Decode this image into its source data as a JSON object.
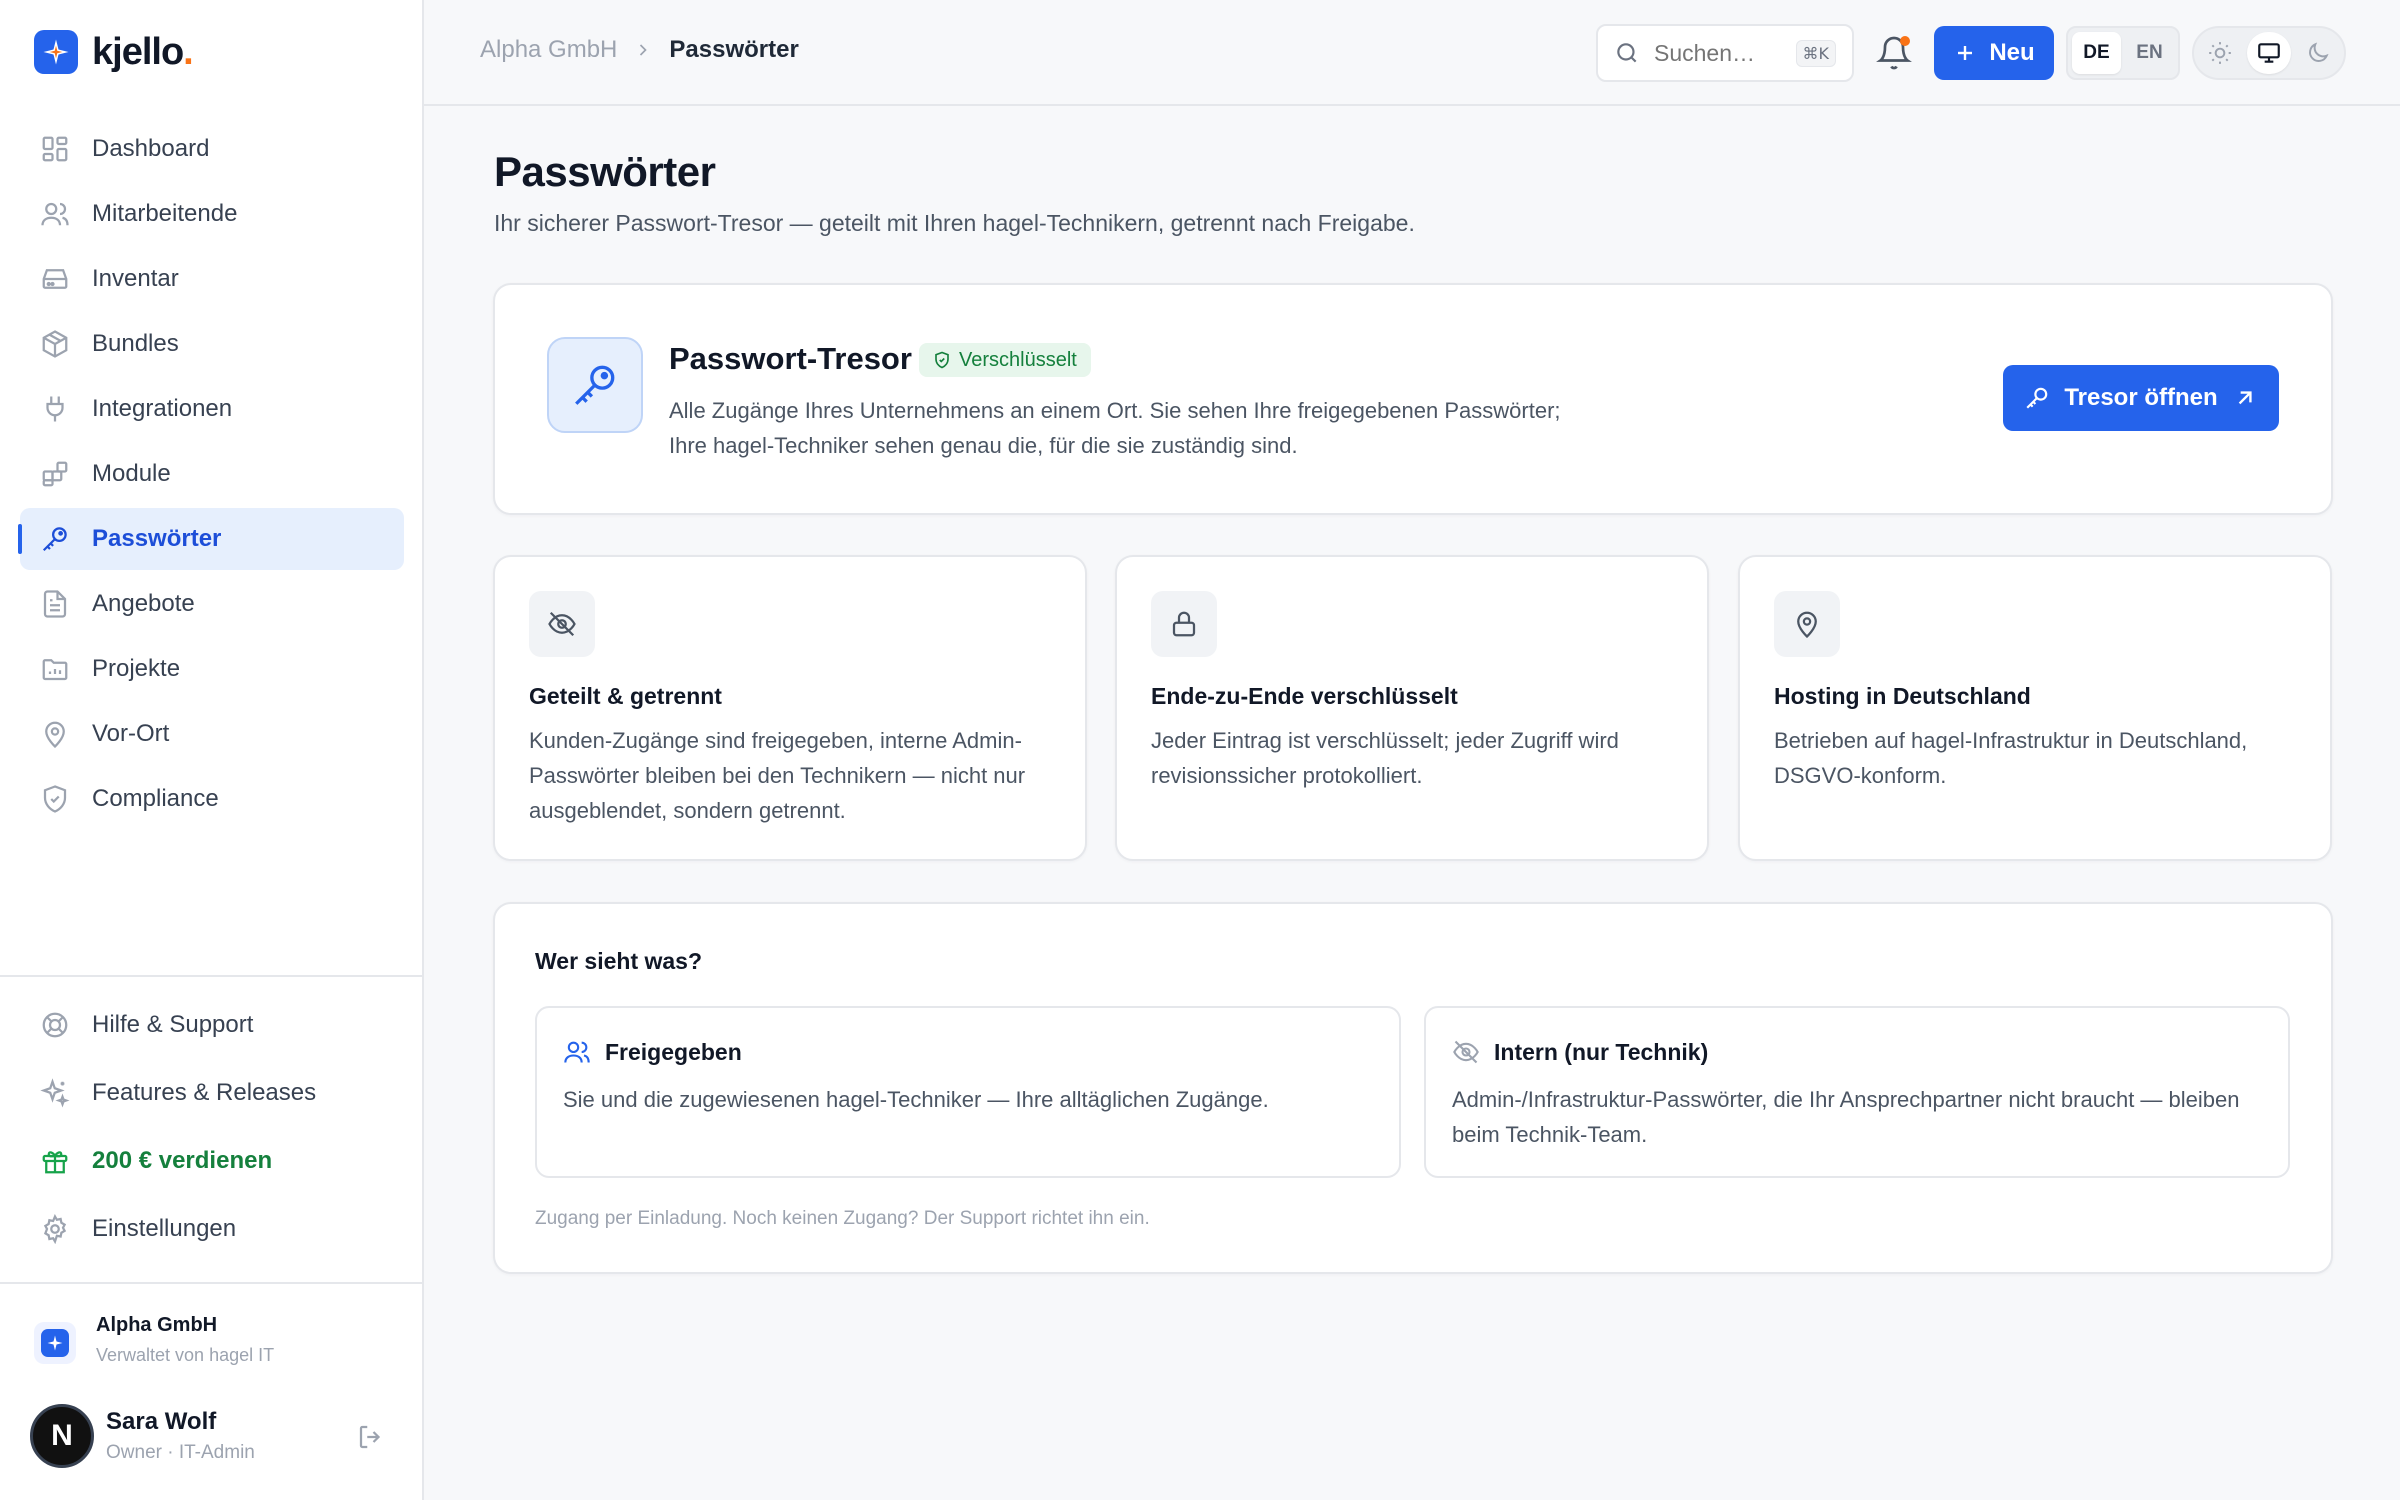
{
  "brand": {
    "name": "kjello",
    "dot": "."
  },
  "sidebar": {
    "items": [
      {
        "label": "Dashboard",
        "icon": "dashboard-icon"
      },
      {
        "label": "Mitarbeitende",
        "icon": "users-icon"
      },
      {
        "label": "Inventar",
        "icon": "hard-drive-icon"
      },
      {
        "label": "Bundles",
        "icon": "package-icon"
      },
      {
        "label": "Integrationen",
        "icon": "plug-icon"
      },
      {
        "label": "Module",
        "icon": "blocks-icon"
      },
      {
        "label": "Passwörter",
        "icon": "key-icon",
        "active": true
      },
      {
        "label": "Angebote",
        "icon": "document-icon"
      },
      {
        "label": "Projekte",
        "icon": "folder-chart-icon"
      },
      {
        "label": "Vor-Ort",
        "icon": "map-pin-icon"
      },
      {
        "label": "Compliance",
        "icon": "shield-check-icon"
      }
    ],
    "bottom": [
      {
        "label": "Hilfe & Support",
        "icon": "lifebuoy-icon"
      },
      {
        "label": "Features & Releases",
        "icon": "sparkles-icon"
      },
      {
        "label": "200 € verdienen",
        "icon": "gift-icon"
      },
      {
        "label": "Einstellungen",
        "icon": "gear-icon"
      }
    ],
    "org": {
      "name": "Alpha GmbH",
      "sub": "Verwaltet von hagel IT"
    },
    "user": {
      "initial": "N",
      "name": "Sara Wolf",
      "role": "Owner · IT-Admin"
    }
  },
  "topbar": {
    "breadcrumb": {
      "parent": "Alpha GmbH",
      "current": "Passwörter"
    },
    "search": {
      "placeholder": "Suchen…",
      "shortcut": "⌘K"
    },
    "new_label": "Neu",
    "languages": [
      "DE",
      "EN"
    ],
    "selected_language": "DE",
    "theme_modes": [
      "light",
      "system",
      "dark"
    ],
    "selected_theme": "system"
  },
  "page": {
    "title": "Passwörter",
    "subtitle": "Ihr sicherer Passwort-Tresor — geteilt mit Ihren hagel-Technikern, getrennt nach Freigabe."
  },
  "vault": {
    "title": "Passwort-Tresor",
    "badge": "Verschlüsselt",
    "desc_line1": "Alle Zugänge Ihres Unternehmens an einem Ort. Sie sehen Ihre freigegebenen Passwörter;",
    "desc_line2": "Ihre hagel-Techniker sehen genau die, für die sie zuständig sind.",
    "button": "Tresor öffnen"
  },
  "features": [
    {
      "title": "Geteilt & getrennt",
      "desc": "Kunden-Zugänge sind freigegeben, interne Admin-Passwörter bleiben bei den Technikern — nicht nur ausgeblendet, sondern getrennt.",
      "icon": "eye-off-icon"
    },
    {
      "title": "Ende-zu-Ende verschlüsselt",
      "desc": "Jeder Eintrag ist verschlüsselt; jeder Zugriff wird revisionssicher protokolliert.",
      "icon": "lock-icon"
    },
    {
      "title": "Hosting in Deutschland",
      "desc": "Betrieben auf hagel-Infrastruktur in Deutschland, DSGVO-konform.",
      "icon": "map-pin-icon"
    }
  ],
  "who": {
    "title": "Wer sieht was?",
    "shared": {
      "title": "Freigegeben",
      "desc": "Sie und die zugewiesenen hagel-Techniker — Ihre alltäglichen Zugänge."
    },
    "internal": {
      "title": "Intern (nur Technik)",
      "desc": "Admin-/Infrastruktur-Passwörter, die Ihr Ansprechpartner nicht braucht — bleiben beim Technik-Team."
    },
    "note": "Zugang per Einladung. Noch keinen Zugang? Der Support richtet ihn ein."
  },
  "colors": {
    "accent": "#2563eb",
    "brand_dot": "#f97316",
    "success": "#15803d"
  }
}
